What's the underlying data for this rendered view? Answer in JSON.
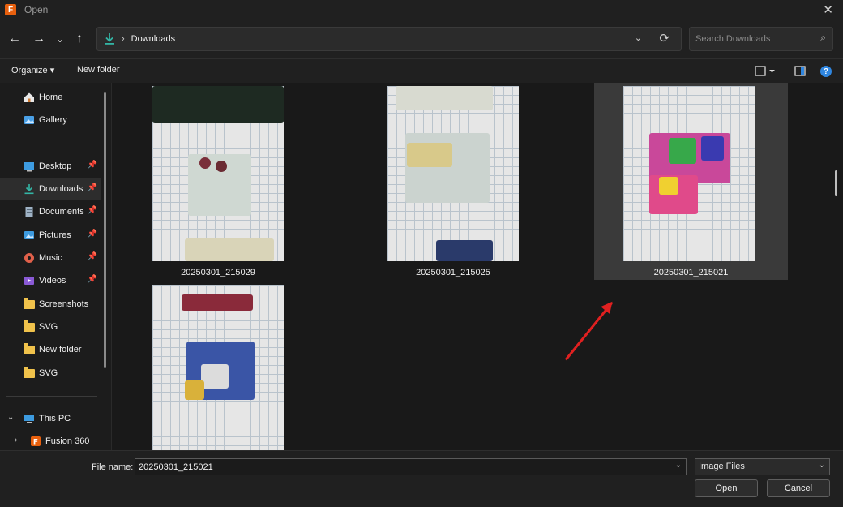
{
  "window": {
    "title": "Open",
    "app_icon_letter": "F"
  },
  "navigation": {
    "back": "←",
    "forward": "→",
    "recent": "⌄",
    "up": "↑",
    "address_path": "Downloads",
    "search_placeholder": "Search Downloads"
  },
  "toolbar": {
    "organize": "Organize ▾",
    "new_folder": "New folder"
  },
  "sidebar": {
    "items": [
      {
        "label": "Home",
        "icon": "home-icon"
      },
      {
        "label": "Gallery",
        "icon": "gallery-icon"
      },
      {
        "label": "Desktop",
        "icon": "desktop-icon",
        "pinned": true
      },
      {
        "label": "Downloads",
        "icon": "downloads-icon",
        "pinned": true,
        "selected": true
      },
      {
        "label": "Documents",
        "icon": "documents-icon",
        "pinned": true
      },
      {
        "label": "Pictures",
        "icon": "pictures-icon",
        "pinned": true
      },
      {
        "label": "Music",
        "icon": "music-icon",
        "pinned": true
      },
      {
        "label": "Videos",
        "icon": "videos-icon",
        "pinned": true
      },
      {
        "label": "Screenshots",
        "icon": "folder-icon"
      },
      {
        "label": "SVG",
        "icon": "folder-icon"
      },
      {
        "label": "New folder",
        "icon": "folder-icon"
      },
      {
        "label": "SVG",
        "icon": "folder-icon"
      },
      {
        "label": "This PC",
        "icon": "this-pc-icon"
      },
      {
        "label": "Fusion 360",
        "icon": "fusion-360-icon"
      }
    ]
  },
  "files": [
    {
      "name": "20250301_215029"
    },
    {
      "name": "20250301_215025"
    },
    {
      "name": "20250301_215021",
      "selected": true
    },
    {
      "name": ""
    }
  ],
  "footer": {
    "file_name_label": "File name:",
    "file_name_value": "20250301_215021",
    "file_type": "Image Files",
    "open_button": "Open",
    "cancel_button": "Cancel"
  },
  "colors": {
    "accent": "#2f86e0",
    "annotation_arrow": "#e02020",
    "folder": "#f0c24b"
  }
}
